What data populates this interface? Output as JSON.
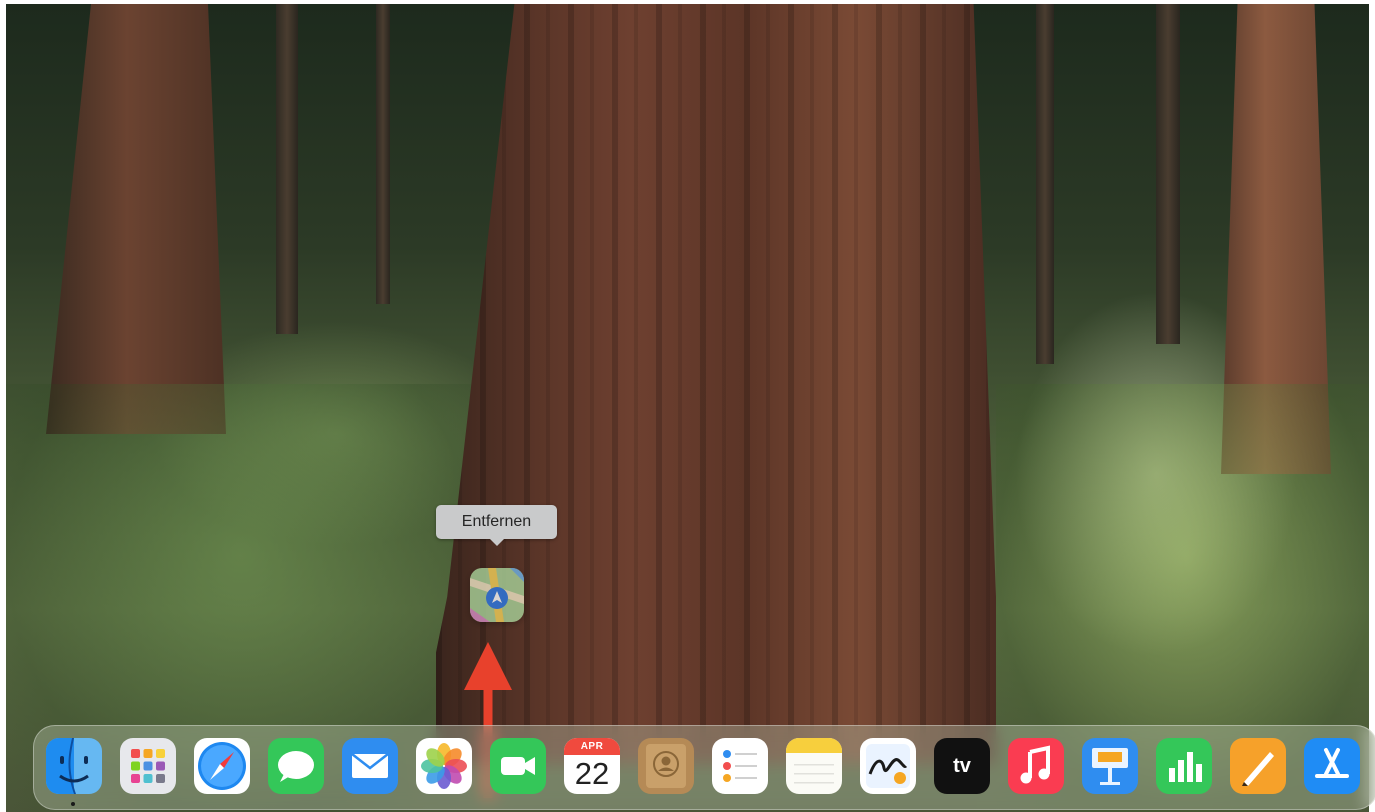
{
  "tooltip": {
    "text": "Entfernen"
  },
  "dragged_icon": {
    "app": "Karten",
    "icon": "maps-icon"
  },
  "annotation": {
    "type": "arrow",
    "color": "#e8412c",
    "direction": "up"
  },
  "dock": {
    "items": [
      {
        "name": "Finder",
        "icon": "finder-icon",
        "running": true
      },
      {
        "name": "Launchpad",
        "icon": "launchpad-icon"
      },
      {
        "name": "Safari",
        "icon": "safari-icon"
      },
      {
        "name": "Nachrichten",
        "icon": "messages-icon"
      },
      {
        "name": "Mail",
        "icon": "mail-icon"
      },
      {
        "name": "Fotos",
        "icon": "photos-icon"
      },
      {
        "name": "FaceTime",
        "icon": "facetime-icon"
      },
      {
        "name": "Kalender",
        "icon": "calendar-icon",
        "month": "APR",
        "day": "22"
      },
      {
        "name": "Kontakte",
        "icon": "contacts-icon"
      },
      {
        "name": "Erinnerungen",
        "icon": "reminders-icon"
      },
      {
        "name": "Notizen",
        "icon": "notes-icon"
      },
      {
        "name": "Freeform",
        "icon": "freeform-icon"
      },
      {
        "name": "TV",
        "icon": "appletv-icon",
        "label": "tv"
      },
      {
        "name": "Musik",
        "icon": "music-icon"
      },
      {
        "name": "Keynote",
        "icon": "keynote-icon"
      },
      {
        "name": "Numbers",
        "icon": "numbers-icon"
      },
      {
        "name": "Pages",
        "icon": "pages-icon"
      },
      {
        "name": "App Store",
        "icon": "appstore-icon"
      }
    ]
  },
  "colors": {
    "tooltip_bg": "#c9cacb",
    "arrow": "#e8412c",
    "calendar_red": "#f04a3e"
  }
}
